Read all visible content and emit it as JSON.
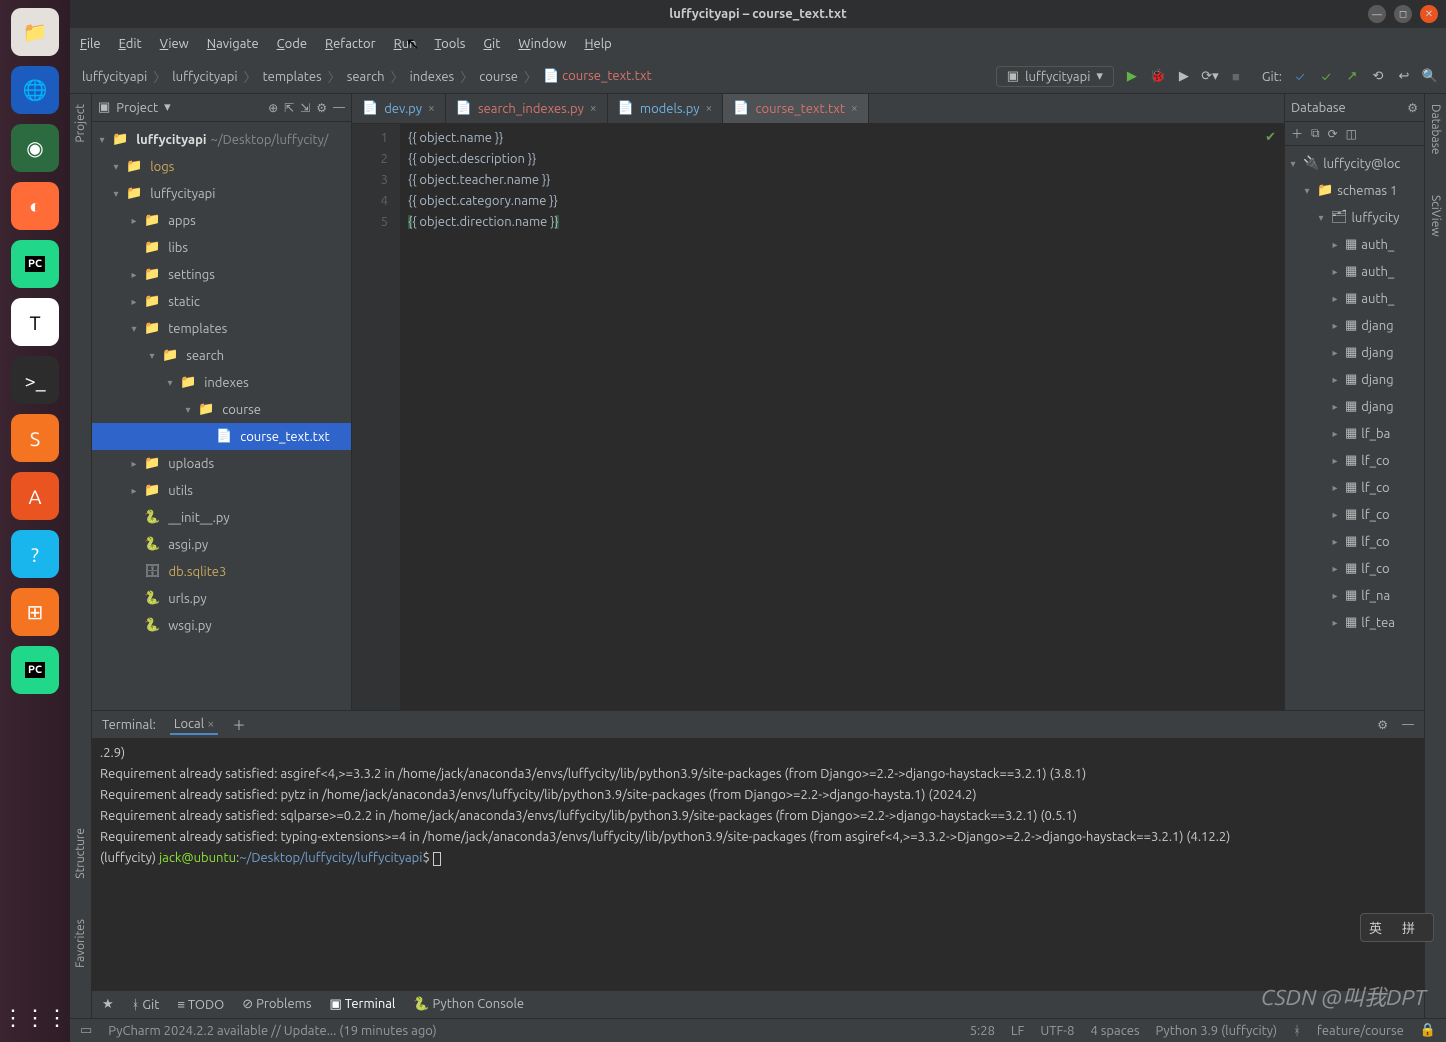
{
  "window": {
    "title": "luffycityapi – course_text.txt"
  },
  "menu": [
    "File",
    "Edit",
    "View",
    "Navigate",
    "Code",
    "Refactor",
    "Run",
    "Tools",
    "Git",
    "Window",
    "Help"
  ],
  "breadcrumbs": [
    "luffycityapi",
    "luffycityapi",
    "templates",
    "search",
    "indexes",
    "course",
    "course_text.txt"
  ],
  "runconfig": "luffycityapi",
  "git_label": "Git:",
  "project_label": "Project",
  "tree": {
    "root": "luffycityapi",
    "root_path": "~/Desktop/luffycity/",
    "items": [
      {
        "l": 1,
        "t": "d",
        "exp": true,
        "name": "logs",
        "cls": "yell"
      },
      {
        "l": 1,
        "t": "d",
        "exp": true,
        "name": "luffycityapi"
      },
      {
        "l": 2,
        "t": "d",
        "exp": false,
        "name": "apps"
      },
      {
        "l": 2,
        "t": "d",
        "exp": null,
        "name": "libs"
      },
      {
        "l": 2,
        "t": "d",
        "exp": false,
        "name": "settings"
      },
      {
        "l": 2,
        "t": "d",
        "exp": false,
        "name": "static"
      },
      {
        "l": 2,
        "t": "d",
        "exp": true,
        "name": "templates"
      },
      {
        "l": 3,
        "t": "d",
        "exp": true,
        "name": "search"
      },
      {
        "l": 4,
        "t": "d",
        "exp": true,
        "name": "indexes"
      },
      {
        "l": 5,
        "t": "d",
        "exp": true,
        "name": "course"
      },
      {
        "l": 6,
        "t": "f",
        "exp": null,
        "name": "course_text.txt",
        "sel": true
      },
      {
        "l": 2,
        "t": "d",
        "exp": false,
        "name": "uploads"
      },
      {
        "l": 2,
        "t": "d",
        "exp": false,
        "name": "utils"
      },
      {
        "l": 2,
        "t": "py",
        "exp": null,
        "name": "__init__.py"
      },
      {
        "l": 2,
        "t": "py",
        "exp": null,
        "name": "asgi.py"
      },
      {
        "l": 2,
        "t": "db",
        "exp": null,
        "name": "db.sqlite3",
        "cls": "yell"
      },
      {
        "l": 2,
        "t": "py",
        "exp": null,
        "name": "urls.py"
      },
      {
        "l": 2,
        "t": "py",
        "exp": null,
        "name": "wsgi.py"
      }
    ]
  },
  "tabs": [
    {
      "name": "dev.py",
      "active": false,
      "red": false
    },
    {
      "name": "search_indexes.py",
      "active": false,
      "red": true
    },
    {
      "name": "models.py",
      "active": false,
      "red": false
    },
    {
      "name": "course_text.txt",
      "active": true,
      "red": true
    }
  ],
  "code_lines": [
    "{{ object.name }}",
    "{{ object.description }}",
    "{{ object.teacher.name }}",
    "{{ object.category.name }}",
    "{{ object.direction.name }}"
  ],
  "database_label": "Database",
  "db": {
    "root": "luffycity@loc",
    "schemas": "schemas 1",
    "schema": "luffycity",
    "tables": [
      "auth_",
      "auth_",
      "auth_",
      "djang",
      "djang",
      "djang",
      "djang",
      "lf_ba",
      "lf_co",
      "lf_co",
      "lf_co",
      "lf_co",
      "lf_co",
      "lf_na",
      "lf_tea"
    ]
  },
  "terminal": {
    "label": "Terminal:",
    "tab": "Local",
    "lines": [
      ".2.9)",
      "Requirement already satisfied: asgiref<4,>=3.3.2 in /home/jack/anaconda3/envs/luffycity/lib/python3.9/site-packages (from Django>=2.2->django-haystack==3.2.1) (3.8.1)",
      "Requirement already satisfied: pytz in /home/jack/anaconda3/envs/luffycity/lib/python3.9/site-packages (from Django>=2.2->django-haysta.1) (2024.2)",
      "Requirement already satisfied: sqlparse>=0.2.2 in /home/jack/anaconda3/envs/luffycity/lib/python3.9/site-packages (from Django>=2.2->django-haystack==3.2.1) (0.5.1)",
      "Requirement already satisfied: typing-extensions>=4 in /home/jack/anaconda3/envs/luffycity/lib/python3.9/site-packages (from asgiref<4,>=3.3.2->Django>=2.2->django-haystack==3.2.1) (4.12.2)"
    ],
    "prompt_env": "(luffycity) ",
    "prompt_user": "jack@ubuntu",
    "prompt_path": "~/Desktop/luffycity/luffycityapi",
    "prompt_end": "$"
  },
  "bottom_tools": [
    "Git",
    "TODO",
    "Problems",
    "Terminal",
    "Python Console"
  ],
  "status": {
    "update": "PyCharm 2024.2.2 available // Update... (19 minutes ago)",
    "pos": "5:28",
    "sep": "LF",
    "enc": "UTF-8",
    "indent": "4 spaces",
    "python": "Python 3.9 (luffycity)",
    "branch": "feature/course"
  },
  "sidebars": {
    "project": "Project",
    "structure": "Structure",
    "favorites": "Favorites",
    "database": "Database",
    "sciview": "SciView"
  },
  "ime": [
    "英",
    "",
    "拼",
    ""
  ],
  "watermark": "CSDN @叫我DPT"
}
